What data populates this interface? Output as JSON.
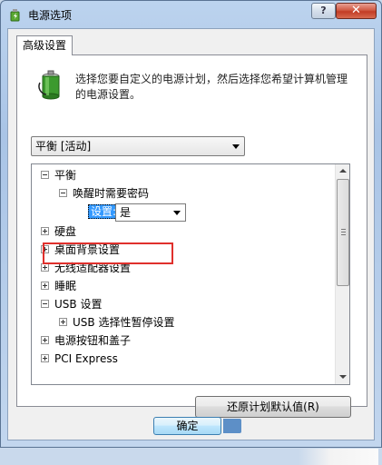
{
  "window": {
    "title": "电源选项",
    "help_label": "?",
    "close_label": "✕"
  },
  "tabs": [
    {
      "label": "高级设置"
    }
  ],
  "description": "选择您要自定义的电源计划，然后选择您希望计算机管理的电源设置。",
  "plan_select": {
    "value": "平衡 [活动]"
  },
  "tree": {
    "items": [
      {
        "label": "平衡",
        "state": "expanded"
      },
      {
        "label": "唤醒时需要密码",
        "state": "expanded"
      },
      {
        "setting_label": "设置:",
        "value": "是"
      },
      {
        "label": "硬盘",
        "state": "collapsed"
      },
      {
        "label": "桌面背景设置",
        "state": "collapsed"
      },
      {
        "label": "无线适配器设置",
        "state": "collapsed"
      },
      {
        "label": "睡眠",
        "state": "collapsed"
      },
      {
        "label": "USB 设置",
        "state": "expanded"
      },
      {
        "label": "USB 选择性暂停设置",
        "state": "collapsed"
      },
      {
        "label": "电源按钮和盖子",
        "state": "collapsed"
      },
      {
        "label": "PCI Express",
        "state": "collapsed"
      }
    ]
  },
  "buttons": {
    "restore_defaults": "还原计划默认值(R)",
    "ok": "确定"
  },
  "colors": {
    "highlight_border": "#e0302c",
    "selection": "#3399ff"
  }
}
